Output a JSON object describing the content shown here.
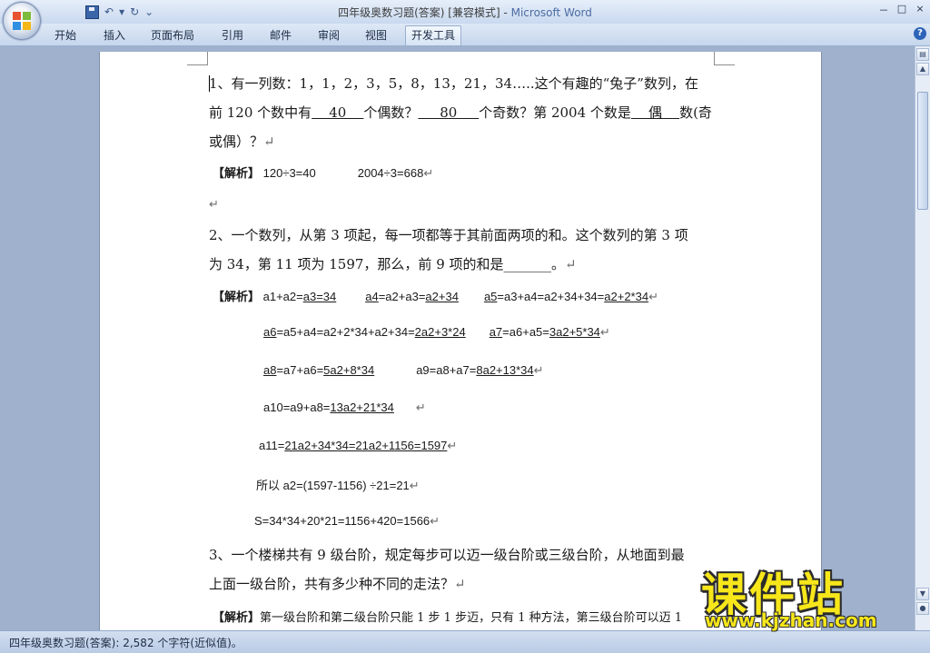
{
  "title": {
    "doc": "四年级奥数习题(答案) [兼容模式] - ",
    "app": "Microsoft Word",
    "controls": [
      "－",
      "□",
      "×"
    ]
  },
  "qat": {
    "undo": "↶",
    "undo_drop": "▾",
    "redo": "↻",
    "customize": "⌄"
  },
  "tabs": [
    "开始",
    "插入",
    "页面布局",
    "引用",
    "邮件",
    "审阅",
    "视图",
    "开发工具"
  ],
  "help": "?",
  "doc": {
    "q1": {
      "a": "1、有一列数：1，1，2，3，5，8，13，21，34…..这个有趣的“兔子”数列，在",
      "b_pre": "前 120 个数中有",
      "b_ans1": "    40    ",
      "b_mid1": "个偶数？",
      "b_ans2": "     80     ",
      "b_mid2": "个奇数？第 2004 个数是",
      "b_ans3": "    偶    ",
      "b_post": "数(奇",
      "c": "或偶）？",
      "sol_label": "【解析】",
      "sol_a": " 120÷3=40",
      "sol_b": "2004÷3=668"
    },
    "q2": {
      "a": "2、一个数列，从第 3 项起，每一项都等于其前面两项的和。这个数列的第 3 项",
      "b": "为 34，第 11 项为 1597，那么，前 9 项的和是",
      "b_blank": "_______",
      "b_end": "。",
      "sol_label": "【解析】",
      "l1_a": " a1+a2=",
      "l1_b": "a3=34",
      "l1_c": "a4",
      "l1_d": "=a2+a3=",
      "l1_e": "a2+34",
      "l1_f": "a5",
      "l1_g": "=a3+a4=a2+34+34=",
      "l1_h": "a2+2*34",
      "l2_a": "a6",
      "l2_b": "=a5+a4=a2+2*34+a2+34=",
      "l2_c": "2a2+3*24",
      "l2_d": "a7",
      "l2_e": "=a6+a5=",
      "l2_f": "3a2+5*34",
      "l3_a": "a8",
      "l3_b": "=a7+a6=",
      "l3_c": "5a2+8*34",
      "l3_d": "a9=a8+a7=",
      "l3_e": "8a2+13*34",
      "l4_a": "a10=a9+a8=",
      "l4_b": "13a2+21*34",
      "l5_a": "a11=",
      "l5_b": "21a2+34*34=21a2+1156=1597",
      "l6": "所以 a2=(1597-1156) ÷21=21",
      "l7": "S=34*34+20*21=1156+420=1566"
    },
    "q3": {
      "a": "3、一个楼梯共有 9 级台阶，规定每步可以迈一级台阶或三级台阶，从地面到最",
      "b": "上面一级台阶，共有多少种不同的走法？",
      "sol_label": "【解析】",
      "sol_text": "第一级台阶和第二级台阶只能 1 步 1 步迈，只有 1 种方法，第三级台阶可以迈 1"
    },
    "para_mark": "↵"
  },
  "status": {
    "text": "四年级奥数习题(答案): 2,582 个字符(近似值)。"
  },
  "watermark": {
    "main": "课件站",
    "url": "www.kjzhan.com"
  },
  "colors": {
    "accent": "#4c6ca3",
    "workspace": "#9fb1cc",
    "watermark": "#f7e71a"
  }
}
